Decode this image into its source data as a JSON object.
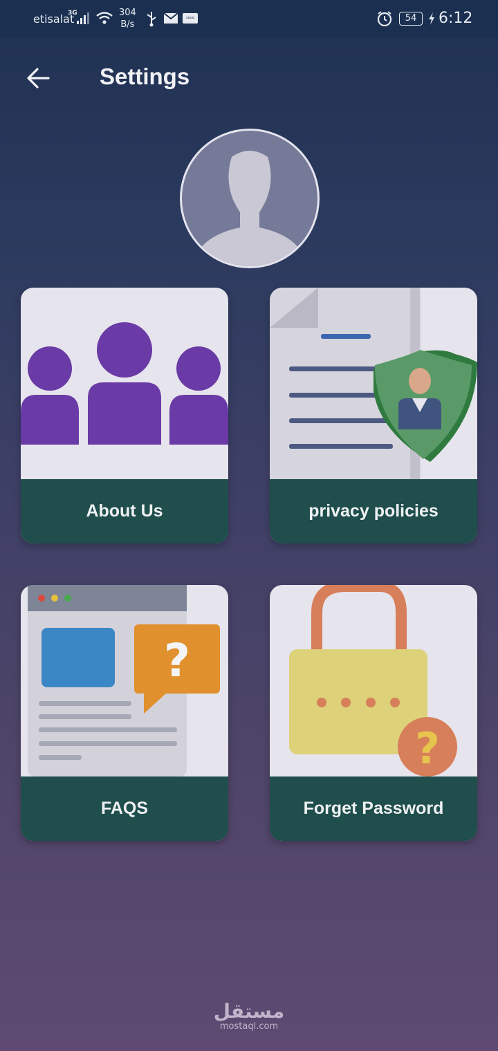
{
  "status_bar": {
    "carrier": "etisalat",
    "network": "3G",
    "speed_value": "304",
    "speed_unit": "B/s",
    "battery": "54",
    "time": "6:12",
    "icons": [
      "signal-icon",
      "wifi-icon",
      "usb-icon",
      "mail-icon",
      "app-notification-icon",
      "alarm-icon",
      "battery-icon",
      "charging-icon"
    ]
  },
  "header": {
    "title": "Settings",
    "back_icon": "arrow-left-icon"
  },
  "profile": {
    "avatar_icon": "user-silhouette-icon"
  },
  "cards": [
    {
      "label": "About Us",
      "icon": "people-group-icon"
    },
    {
      "label": "privacy policies",
      "icon": "document-shield-icon"
    },
    {
      "label": "FAQS",
      "icon": "browser-question-icon"
    },
    {
      "label": "Forget Password",
      "icon": "padlock-question-icon"
    }
  ],
  "watermark": {
    "arabic": "مستقل",
    "domain": "mostaql.com"
  },
  "colors": {
    "card_label_bg": "#1f4e4c",
    "card_bg": "#e6e4ec",
    "purple": "#6a3aa6",
    "green_shield": "#5a9a68",
    "faq_blue": "#3b86c4",
    "faq_orange": "#e0902c",
    "lock_yellow": "#ddd27a",
    "lock_orange": "#d77e5a"
  }
}
